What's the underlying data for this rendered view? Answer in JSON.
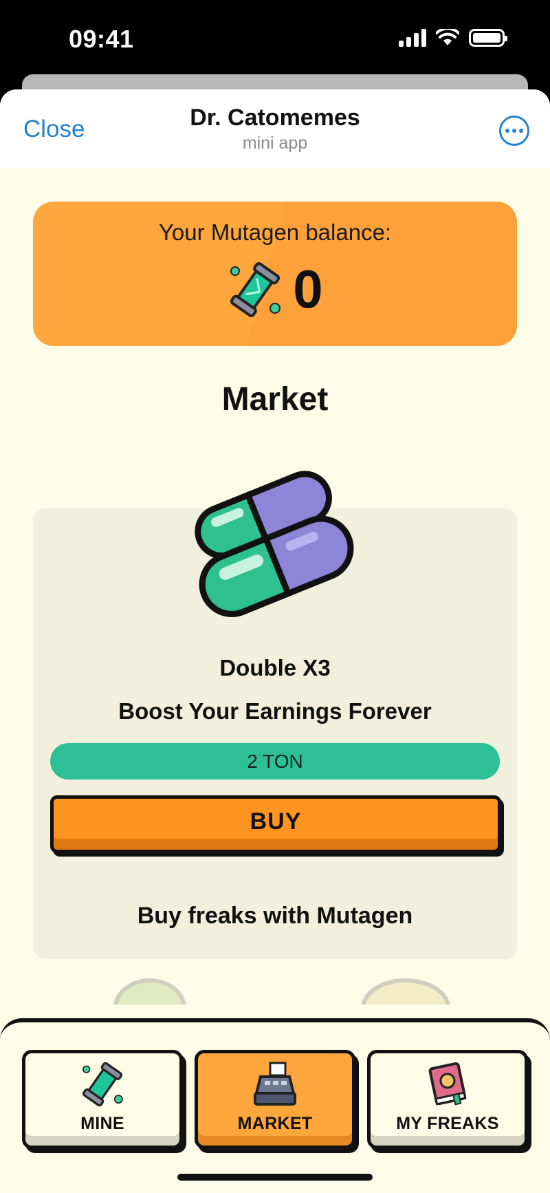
{
  "status": {
    "time": "09:41"
  },
  "header": {
    "close_label": "Close",
    "title": "Dr. Catomemes",
    "subtitle": "mini app"
  },
  "balance": {
    "label": "Your Mutagen balance:",
    "value": "0"
  },
  "market": {
    "title": "Market",
    "product": {
      "name": "Double X3",
      "description": "Boost Your Earnings Forever",
      "price": "2 TON",
      "buy_label": "BUY"
    },
    "freaks_title": "Buy freaks with Mutagen"
  },
  "nav": [
    {
      "label": "MINE",
      "icon": "mutagen-vial-icon",
      "active": false
    },
    {
      "label": "MARKET",
      "icon": "cash-register-icon",
      "active": true
    },
    {
      "label": "MY FREAKS",
      "icon": "freaks-book-icon",
      "active": false
    }
  ],
  "colors": {
    "accent_orange": "#ffa63d",
    "price_green": "#2dc094",
    "link_blue": "#2481cc",
    "background": "#fdfce6"
  }
}
